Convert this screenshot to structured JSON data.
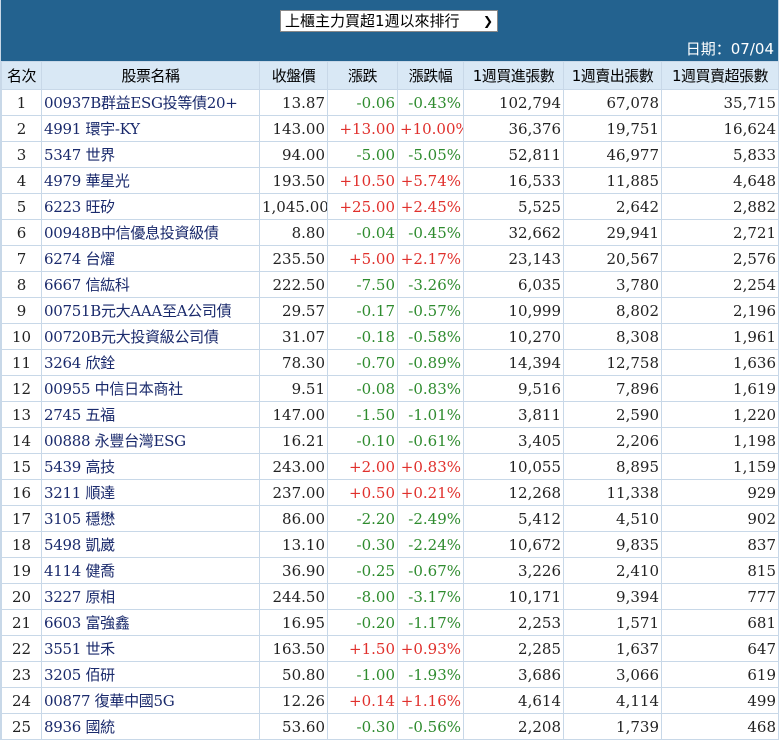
{
  "header": {
    "selector_label": "上櫃主力買超1週以來排行",
    "date_label": "日期：07/04"
  },
  "columns": [
    "名次",
    "股票名稱",
    "收盤價",
    "漲跌",
    "漲跌幅",
    "1週買進張數",
    "1週賣出張數",
    "1週買賣超張數"
  ],
  "colors": {
    "header_bg": "#23628f",
    "up": "#e0302c",
    "down": "#2e8b2e"
  },
  "rows": [
    [
      "1",
      "00937B群益ESG投等債20+",
      "13.87",
      "-0.06",
      "-0.43%",
      "102,794",
      "67,078",
      "35,715"
    ],
    [
      "2",
      "4991 環宇-KY",
      "143.00",
      "+13.00",
      "+10.00%",
      "36,376",
      "19,751",
      "16,624"
    ],
    [
      "3",
      "5347 世界",
      "94.00",
      "-5.00",
      "-5.05%",
      "52,811",
      "46,977",
      "5,833"
    ],
    [
      "4",
      "4979 華星光",
      "193.50",
      "+10.50",
      "+5.74%",
      "16,533",
      "11,885",
      "4,648"
    ],
    [
      "5",
      "6223 旺矽",
      "1,045.00",
      "+25.00",
      "+2.45%",
      "5,525",
      "2,642",
      "2,882"
    ],
    [
      "6",
      "00948B中信優息投資級債",
      "8.80",
      "-0.04",
      "-0.45%",
      "32,662",
      "29,941",
      "2,721"
    ],
    [
      "7",
      "6274 台燿",
      "235.50",
      "+5.00",
      "+2.17%",
      "23,143",
      "20,567",
      "2,576"
    ],
    [
      "8",
      "6667 信紘科",
      "222.50",
      "-7.50",
      "-3.26%",
      "6,035",
      "3,780",
      "2,254"
    ],
    [
      "9",
      "00751B元大AAA至A公司債",
      "29.57",
      "-0.17",
      "-0.57%",
      "10,999",
      "8,802",
      "2,196"
    ],
    [
      "10",
      "00720B元大投資級公司債",
      "31.07",
      "-0.18",
      "-0.58%",
      "10,270",
      "8,308",
      "1,961"
    ],
    [
      "11",
      "3264 欣銓",
      "78.30",
      "-0.70",
      "-0.89%",
      "14,394",
      "12,758",
      "1,636"
    ],
    [
      "12",
      "00955 中信日本商社",
      "9.51",
      "-0.08",
      "-0.83%",
      "9,516",
      "7,896",
      "1,619"
    ],
    [
      "13",
      "2745 五福",
      "147.00",
      "-1.50",
      "-1.01%",
      "3,811",
      "2,590",
      "1,220"
    ],
    [
      "14",
      "00888 永豐台灣ESG",
      "16.21",
      "-0.10",
      "-0.61%",
      "3,405",
      "2,206",
      "1,198"
    ],
    [
      "15",
      "5439 高技",
      "243.00",
      "+2.00",
      "+0.83%",
      "10,055",
      "8,895",
      "1,159"
    ],
    [
      "16",
      "3211 順達",
      "237.00",
      "+0.50",
      "+0.21%",
      "12,268",
      "11,338",
      "929"
    ],
    [
      "17",
      "3105 穩懋",
      "86.00",
      "-2.20",
      "-2.49%",
      "5,412",
      "4,510",
      "902"
    ],
    [
      "18",
      "5498 凱崴",
      "13.10",
      "-0.30",
      "-2.24%",
      "10,672",
      "9,835",
      "837"
    ],
    [
      "19",
      "4114 健喬",
      "36.90",
      "-0.25",
      "-0.67%",
      "3,226",
      "2,410",
      "815"
    ],
    [
      "20",
      "3227 原相",
      "244.50",
      "-8.00",
      "-3.17%",
      "10,171",
      "9,394",
      "777"
    ],
    [
      "21",
      "6603 富強鑫",
      "16.95",
      "-0.20",
      "-1.17%",
      "2,253",
      "1,571",
      "681"
    ],
    [
      "22",
      "3551 世禾",
      "163.50",
      "+1.50",
      "+0.93%",
      "2,285",
      "1,637",
      "647"
    ],
    [
      "23",
      "3205 佰研",
      "50.80",
      "-1.00",
      "-1.93%",
      "3,686",
      "3,066",
      "619"
    ],
    [
      "24",
      "00877 復華中國5G",
      "12.26",
      "+0.14",
      "+1.16%",
      "4,614",
      "4,114",
      "499"
    ],
    [
      "25",
      "8936 國統",
      "53.60",
      "-0.30",
      "-0.56%",
      "2,208",
      "1,739",
      "468"
    ]
  ]
}
